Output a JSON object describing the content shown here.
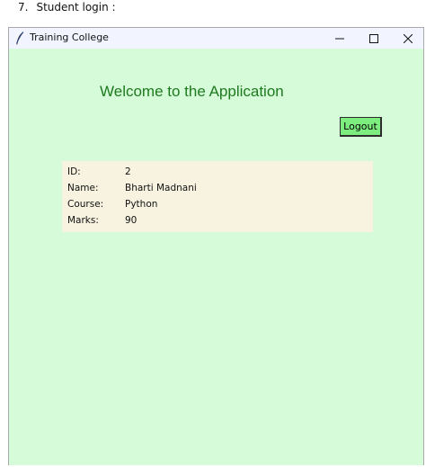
{
  "doc": {
    "number": "7.",
    "heading": "Student login :"
  },
  "window": {
    "title": "Training College",
    "icon": "feather-icon",
    "controls": {
      "minimize": "minimize-icon",
      "maximize": "maximize-icon",
      "close": "close-icon"
    }
  },
  "app": {
    "welcome": "Welcome to the Application",
    "logout_label": "Logout",
    "student": [
      {
        "label": "ID:",
        "value": "2"
      },
      {
        "label": "Name:",
        "value": "Bharti Madnani"
      },
      {
        "label": "Course:",
        "value": "Python"
      },
      {
        "label": "Marks:",
        "value": "90"
      }
    ]
  },
  "colors": {
    "window_bg": "#d6fbd9",
    "welcome_text": "#1e7a1e",
    "logout_bg": "#7ded7f",
    "panel_bg": "#f7f3e0"
  }
}
